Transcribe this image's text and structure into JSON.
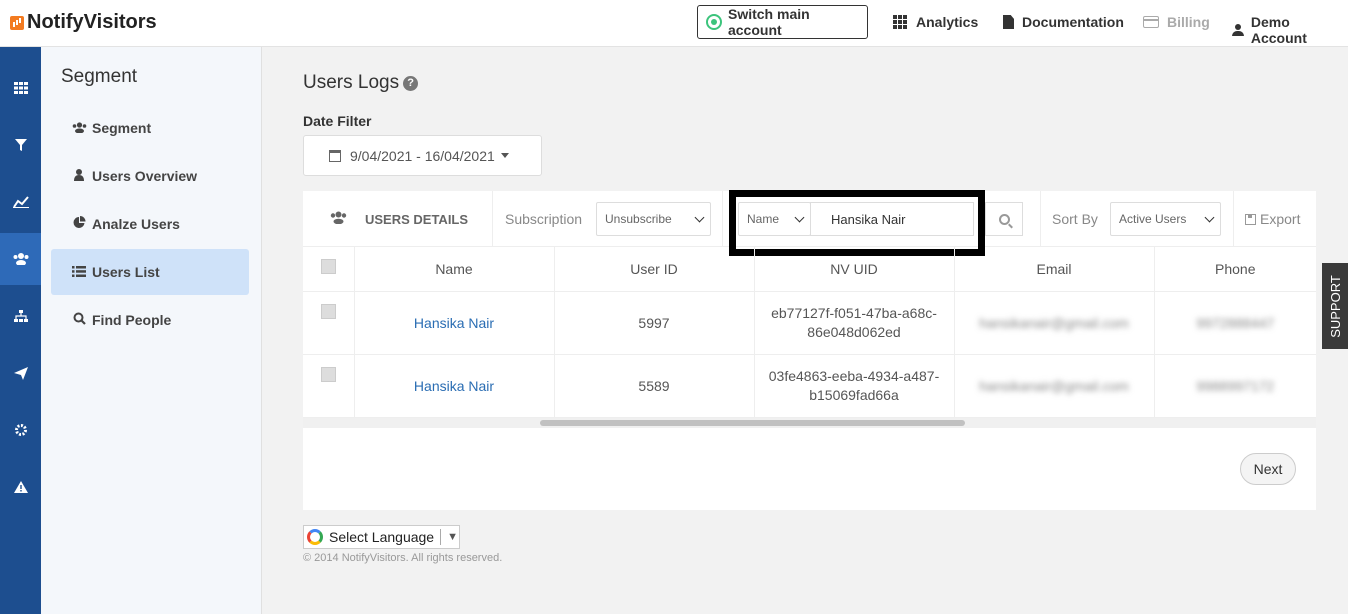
{
  "header": {
    "logo_text": "NotifyVisitors",
    "switch_label": "Switch main account",
    "nav": [
      "Analytics",
      "Documentation",
      "Billing",
      "Demo Account"
    ]
  },
  "sidebar": {
    "title": "Segment",
    "items": [
      "Segment",
      "Users Overview",
      "Analze Users",
      "Users List",
      "Find People"
    ]
  },
  "main": {
    "title": "Users Logs",
    "date_filter_label": "Date Filter",
    "date_range": "9/04/2021 - 16/04/2021",
    "toolbar": {
      "users_details": "USERS DETAILS",
      "subscription_label": "Subscription",
      "subscription_value": "Unsubscribe",
      "field_value": "Name",
      "search_value": "Hansika Nair",
      "sort_label": "Sort By",
      "sort_value": "Active Users",
      "export_label": "Export"
    },
    "table": {
      "columns": [
        "Name",
        "User ID",
        "NV UID",
        "Email",
        "Phone"
      ],
      "rows": [
        {
          "name": "Hansika Nair",
          "user_id": "5997",
          "nvuid": "eb77127f-f051-47ba-a68c-86e048d062ed",
          "email": "hansikanair@gmail.com",
          "phone": "9972888447"
        },
        {
          "name": "Hansika Nair",
          "user_id": "5589",
          "nvuid": "03fe4863-eeba-4934-a487-b15069fad66a",
          "email": "hansikanair@gmail.com",
          "phone": "9988997172"
        }
      ]
    },
    "next_label": "Next"
  },
  "footer": {
    "language_label": "Select Language",
    "copyright": "© 2014 NotifyVisitors. All rights reserved."
  },
  "support_label": "SUPPORT",
  "colors": {
    "iconbar": "#1d4e8f",
    "active_nav": "#cfe2f9",
    "link": "#2a6db3",
    "switch_ring": "#3cc47c"
  }
}
